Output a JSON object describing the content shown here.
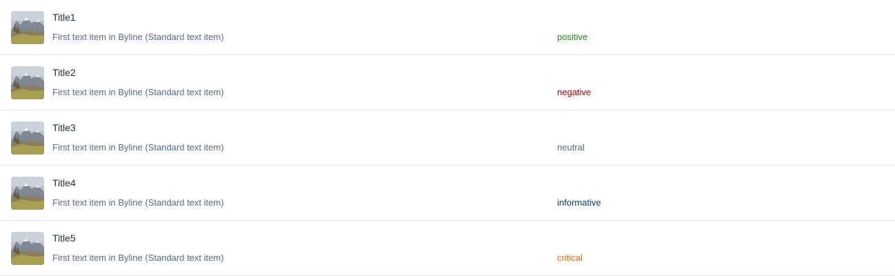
{
  "list": {
    "items": [
      {
        "title": "Title1",
        "byline": "First text item in Byline (Standard text item)",
        "status": "positive",
        "status_color": "#188918",
        "image": "mountain-landscape-thumbnail"
      },
      {
        "title": "Title2",
        "byline": "First text item in Byline (Standard text item)",
        "status": "negative",
        "status_color": "#bb0000",
        "image": "mountain-landscape-thumbnail"
      },
      {
        "title": "Title3",
        "byline": "First text item in Byline (Standard text item)",
        "status": "neutral",
        "status_color": "#556b82",
        "image": "mountain-landscape-thumbnail"
      },
      {
        "title": "Title4",
        "byline": "First text item in Byline (Standard text item)",
        "status": "informative",
        "status_color": "#0a3c7a",
        "image": "mountain-landscape-thumbnail"
      },
      {
        "title": "Title5",
        "byline": "First text item in Byline (Standard text item)",
        "status": "critical",
        "status_color": "#e76500",
        "image": "mountain-landscape-thumbnail"
      }
    ]
  }
}
